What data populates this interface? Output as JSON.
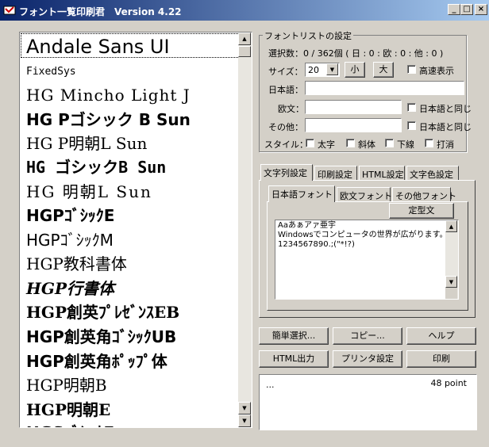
{
  "window": {
    "title": "フォント一覧印刷君　Version 4.22",
    "minimize": "_",
    "maximize": "□",
    "close": "×"
  },
  "font_list": {
    "items": [
      {
        "label": "Andale Sans UI",
        "font": "DejaVu Sans",
        "size": 24,
        "weight": "normal",
        "style": "normal",
        "spacing": 0
      },
      {
        "label": "FixedSys",
        "font": "DejaVu Sans Mono",
        "size": 13,
        "weight": "normal",
        "style": "normal",
        "spacing": 0
      },
      {
        "label": "HG Mincho Light J",
        "font": "DejaVu Serif",
        "size": 20,
        "weight": "normal",
        "style": "normal",
        "spacing": 1
      },
      {
        "label": "HG Pゴシック B Sun",
        "font": "DejaVu Sans",
        "size": 20,
        "weight": "bold",
        "style": "normal",
        "spacing": 0
      },
      {
        "label": "HG P明朝L Sun",
        "font": "DejaVu Serif",
        "size": 20,
        "weight": "normal",
        "style": "normal",
        "spacing": 0
      },
      {
        "label": "HG ゴシックB Sun",
        "font": "DejaVu Sans Mono",
        "size": 20,
        "weight": "bold",
        "style": "normal",
        "spacing": 0
      },
      {
        "label": "HG 明朝L Sun",
        "font": "DejaVu Serif",
        "size": 20,
        "weight": "normal",
        "style": "normal",
        "spacing": 2
      },
      {
        "label": "HGPｺﾞｼｯｸE",
        "font": "DejaVu Sans",
        "size": 20,
        "weight": "bold",
        "style": "normal",
        "spacing": 0
      },
      {
        "label": "HGPｺﾞｼｯｸM",
        "font": "DejaVu Sans",
        "size": 20,
        "weight": "normal",
        "style": "normal",
        "spacing": 0
      },
      {
        "label": "HGP教科書体",
        "font": "DejaVu Serif",
        "size": 20,
        "weight": "normal",
        "style": "normal",
        "spacing": 0
      },
      {
        "label": "HGP行書体",
        "font": "DejaVu Serif",
        "size": 20,
        "weight": "bold",
        "style": "italic",
        "spacing": 0
      },
      {
        "label": "HGP創英ﾌﾟﾚｾﾞﾝｽEB",
        "font": "DejaVu Serif",
        "size": 20,
        "weight": "bold",
        "style": "normal",
        "spacing": 0
      },
      {
        "label": "HGP創英角ｺﾞｼｯｸUB",
        "font": "DejaVu Sans",
        "size": 20,
        "weight": "bold",
        "style": "normal",
        "spacing": 0
      },
      {
        "label": "HGP創英角ﾎﾟｯﾌﾟ体",
        "font": "DejaVu Sans",
        "size": 20,
        "weight": "bold",
        "style": "normal",
        "spacing": 0
      },
      {
        "label": "HGP明朝B",
        "font": "DejaVu Serif",
        "size": 20,
        "weight": "normal",
        "style": "normal",
        "spacing": 0
      },
      {
        "label": "HGP明朝E",
        "font": "DejaVu Serif",
        "size": 20,
        "weight": "bold",
        "style": "normal",
        "spacing": 0
      },
      {
        "label": "HGSｺﾞｼｯｸE",
        "font": "DejaVu Sans",
        "size": 20,
        "weight": "bold",
        "style": "normal",
        "spacing": 0
      }
    ]
  },
  "settings": {
    "legend": "フォントリストの設定",
    "selection_count": "選択数：0 / 362個 ( 日 : 0 : 欧 : 0 : 他 : 0 )",
    "size_label": "サイズ：",
    "size_value": "20",
    "small_button": "小",
    "large_button": "大",
    "fast_display": "高速表示",
    "japanese_label": "日本語：",
    "japanese_value": "",
    "western_label": "欧文：",
    "western_value": "",
    "other_label": "その他：",
    "other_value": "",
    "same_as_japanese": "日本語と同じ",
    "style_label": "スタイル：",
    "bold": "太字",
    "italic": "斜体",
    "underline": "下線",
    "strike": "打消"
  },
  "tabs": {
    "main": [
      "文字列設定",
      "印刷設定",
      "HTML設定",
      "文字色設定"
    ],
    "sub": [
      "日本語フォント",
      "欧文フォント",
      "その他フォント"
    ],
    "template_button": "定型文",
    "sample_lines": [
      "Aaあぁアァ亜宇",
      "Windowsでコンピュータの世界が広がります。",
      "1234567890.;(\"*!?)"
    ]
  },
  "buttons": {
    "simple_select": "簡単選択...",
    "copy": "コピー...",
    "help": "ヘルプ",
    "html_output": "HTML出力",
    "printer_setup": "プリンタ設定",
    "print": "印刷"
  },
  "status": {
    "left": "...",
    "right": "48 point"
  }
}
